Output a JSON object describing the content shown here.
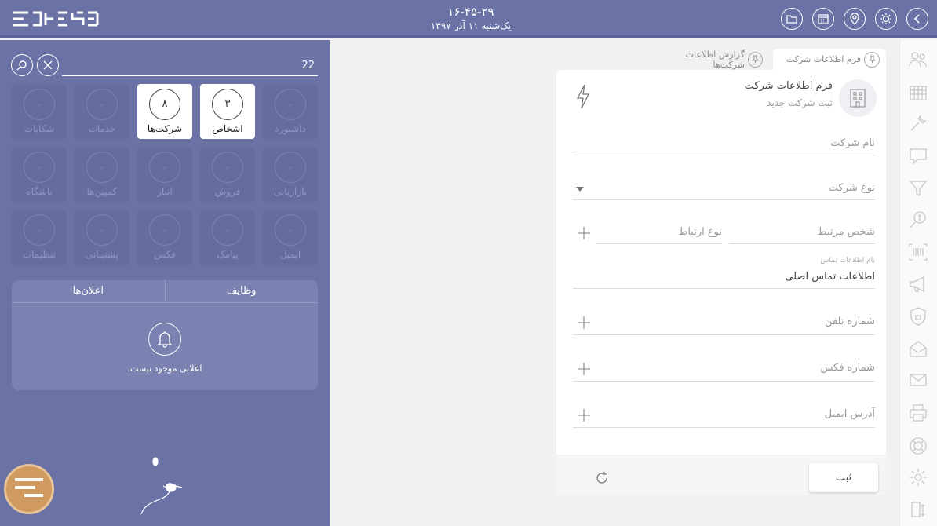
{
  "header": {
    "time": "۱۶-۴۵-۲۹",
    "date": "یک‌شنبه ۱۱ آذر ۱۳۹۷"
  },
  "search": {
    "value": "22",
    "placeholder": ""
  },
  "tiles": [
    {
      "label": "داشبورد",
      "count": "۰",
      "active": false
    },
    {
      "label": "اشخاص",
      "count": "۳",
      "active": true
    },
    {
      "label": "شرکت‌ها",
      "count": "۸",
      "active": true
    },
    {
      "label": "خدمات",
      "count": "۰",
      "active": false
    },
    {
      "label": "شکایات",
      "count": "۰",
      "active": false
    },
    {
      "label": "بازاریابی",
      "count": "۰",
      "active": false
    },
    {
      "label": "فروش",
      "count": "۰",
      "active": false
    },
    {
      "label": "انبار",
      "count": "۰",
      "active": false
    },
    {
      "label": "کمپین‌ها",
      "count": "۰",
      "active": false
    },
    {
      "label": "باشگاه",
      "count": "۰",
      "active": false
    },
    {
      "label": "ایمیل",
      "count": "۰",
      "active": false
    },
    {
      "label": "پیامک",
      "count": "۰",
      "active": false
    },
    {
      "label": "فکس",
      "count": "۰",
      "active": false
    },
    {
      "label": "پشتیبانی",
      "count": "۰",
      "active": false
    },
    {
      "label": "تنظیمات",
      "count": "۰",
      "active": false
    }
  ],
  "notifications": {
    "tab_tasks": "وظایف",
    "tab_announcements": "اعلان‌ها",
    "empty_message": "اعلانی موجود نیست."
  },
  "tabs": [
    {
      "label": "فرم اطلاعات شرکت",
      "active": true
    },
    {
      "label": "گزارش اطلاعات شرکت‌ها",
      "active": false
    }
  ],
  "form": {
    "title": "فرم اطلاعات شرکت",
    "subtitle": "ثبت شرکت جدید",
    "company_name_placeholder": "نام شرکت",
    "company_type_placeholder": "نوع شرکت",
    "related_person_placeholder": "شخص مرتبط",
    "relation_type_placeholder": "نوع ارتباط",
    "contact_name_label": "نام اطلاعات تماس",
    "contact_name_value": "اطلاعات تماس اصلی",
    "phone_placeholder": "شماره تلفن",
    "fax_placeholder": "شماره فکس",
    "email_placeholder": "آدرس ایمیل",
    "submit_label": "ثبت"
  },
  "colors": {
    "primary": "#6a72a6",
    "tile_inactive": "#646ca0",
    "brand_orange": "#d19a5e"
  },
  "icons": {
    "top_bar": [
      "chevron-left-icon",
      "sun-icon",
      "location-pin-icon",
      "calendar-icon",
      "folder-icon"
    ],
    "right_sidebar": [
      "users-icon",
      "building-icon",
      "tools-icon",
      "chat-icon",
      "filter-icon",
      "money-search-icon",
      "barcode-icon",
      "megaphone-icon",
      "shield-icon",
      "inbox-icon",
      "sms-icon",
      "printer-icon",
      "lifebuoy-icon",
      "gear-icon",
      "transfer-icon"
    ]
  }
}
